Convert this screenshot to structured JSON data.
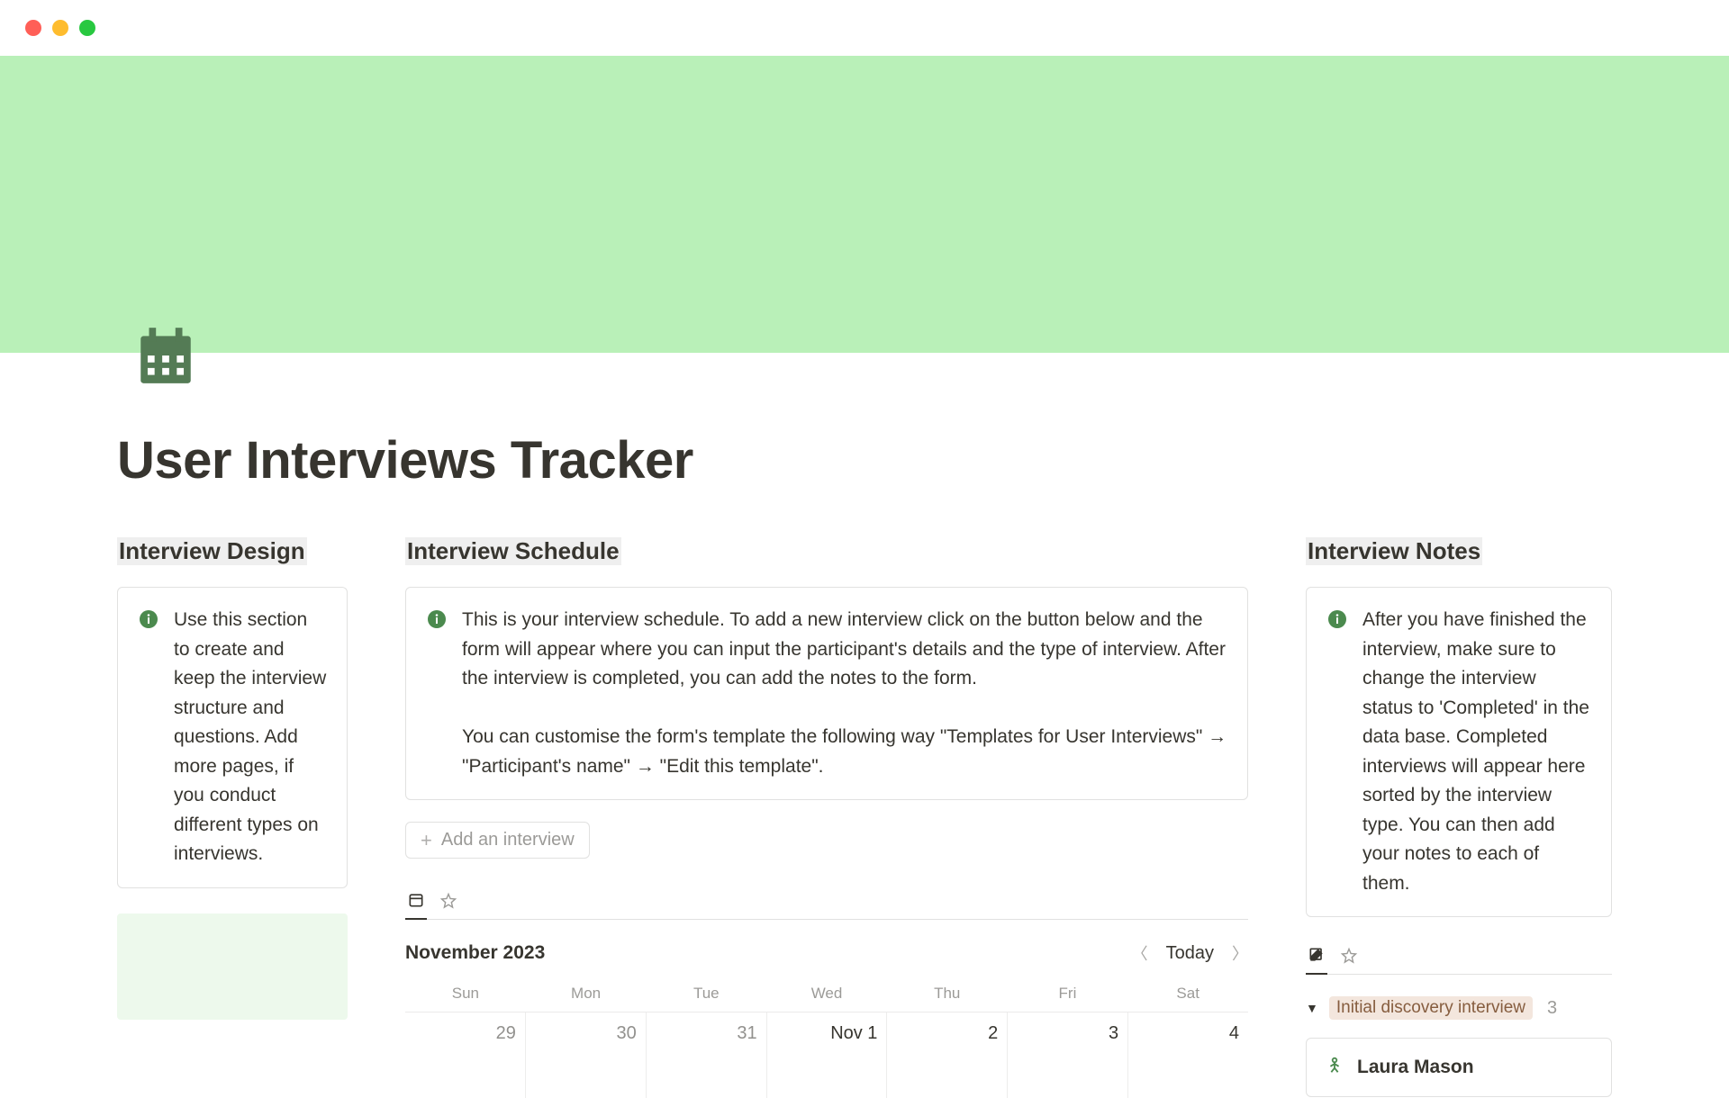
{
  "page": {
    "title": "User Interviews Tracker"
  },
  "design": {
    "heading": "Interview Design",
    "callout": "Use this section to create and keep the interview structure and questions. Add more pages, if you conduct different types on interviews."
  },
  "schedule": {
    "heading": "Interview Schedule",
    "callout": "This is your interview schedule. To add a new interview click on the button below and the form will appear where you can input the participant's details and the type of interview. After the interview is completed, you can add the notes to the form.\n\nYou can customise the form's template the following way \"Templates for User Interviews\" → \"Participant's name\" → \"Edit this template\".",
    "add_label": "Add an interview",
    "calendar": {
      "month": "November 2023",
      "today_label": "Today",
      "weekdays": [
        "Sun",
        "Mon",
        "Tue",
        "Wed",
        "Thu",
        "Fri",
        "Sat"
      ],
      "dates": [
        {
          "label": "29",
          "current": false
        },
        {
          "label": "30",
          "current": false
        },
        {
          "label": "31",
          "current": false
        },
        {
          "label": "Nov 1",
          "current": true
        },
        {
          "label": "2",
          "current": true
        },
        {
          "label": "3",
          "current": true
        },
        {
          "label": "4",
          "current": true
        }
      ]
    }
  },
  "notes": {
    "heading": "Interview Notes",
    "callout": "After you have finished the interview, make sure to change the interview status to 'Completed' in the data base. Completed interviews will appear here sorted by the interview type. You can then add your notes to each of them.",
    "group": {
      "name": "Initial discovery interview",
      "count": "3"
    },
    "items": [
      {
        "name": "Laura Mason"
      }
    ]
  }
}
